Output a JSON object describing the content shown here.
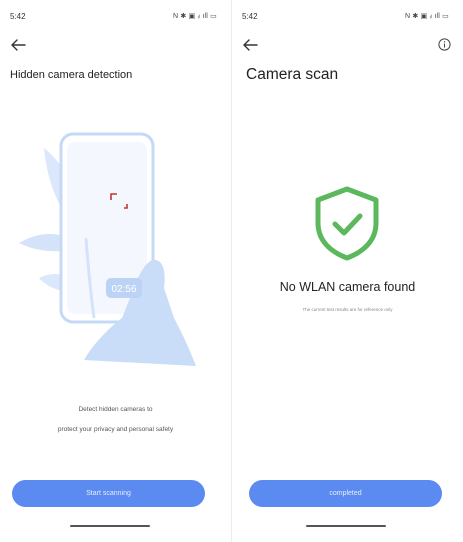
{
  "left_screen": {
    "status_time": "5:42",
    "status_icons": "N ✱ ▣ ᵢₗ ıll ▭",
    "title": "Hidden camera detection",
    "illustration_timer": "02:56",
    "description_line1": "Detect hidden cameras to",
    "description_line2": "protect your privacy and personal safety",
    "button_label": "Start scanning"
  },
  "right_screen": {
    "status_time": "5:42",
    "status_icons": "N ✱ ▣ ᵢₗ ıll ▭",
    "title": "Camera scan",
    "result_title": "No WLAN camera found",
    "result_subtitle": "The current test results are for reference only",
    "button_label": "completed"
  },
  "colors": {
    "accent": "#5b8af0",
    "success": "#5cb85c",
    "illustration": "#c9dcf8"
  },
  "icons": {
    "back": "arrow-left-icon",
    "info": "info-icon",
    "shield": "shield-check-icon"
  }
}
